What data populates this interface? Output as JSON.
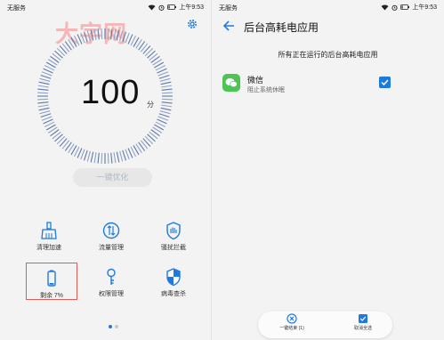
{
  "colors": {
    "accent": "#1f7ae0",
    "watermark": "#f4b7b7",
    "highlight": "#e05a5a"
  },
  "left": {
    "status": {
      "carrier": "无服务",
      "time": "上午9:53"
    },
    "watermark": "大字网",
    "score": "100",
    "score_unit": "分",
    "optimize_button": "一键优化",
    "tools": [
      {
        "label": "清理加速",
        "icon": "broom-icon"
      },
      {
        "label": "流量管理",
        "icon": "data-usage-icon"
      },
      {
        "label": "骚扰拦截",
        "icon": "shield-hand-icon"
      },
      {
        "label": "剩余 7%",
        "icon": "battery-icon"
      },
      {
        "label": "权限管理",
        "icon": "key-icon"
      },
      {
        "label": "病毒查杀",
        "icon": "virus-shield-icon"
      }
    ]
  },
  "right": {
    "status": {
      "carrier": "无服务",
      "time": "上午9:53"
    },
    "title": "后台高耗电应用",
    "subtitle": "所有正在运行的后台高耗电应用",
    "apps": [
      {
        "name": "微信",
        "desc": "阻止系统休眠",
        "checked": true,
        "icon": "wechat-icon"
      }
    ],
    "bottom_actions": [
      {
        "label": "一键结束 (1)",
        "icon": "close-circle-icon"
      },
      {
        "label": "取消全选",
        "icon": "checkbox-icon"
      }
    ]
  }
}
